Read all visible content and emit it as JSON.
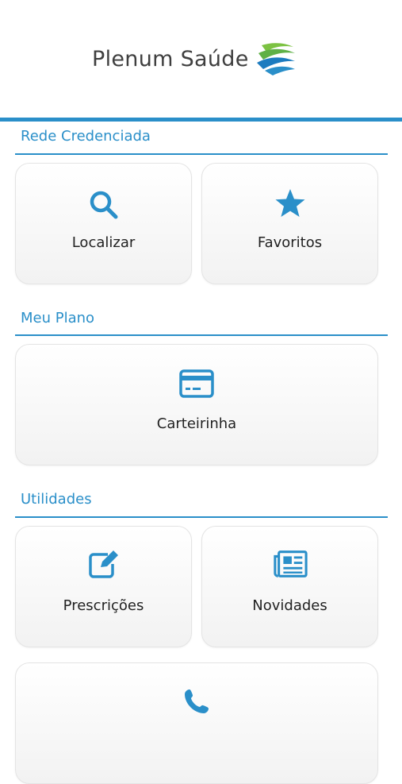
{
  "header": {
    "logo_text": "Plenum Saúde"
  },
  "colors": {
    "accent": "#2a8fc9",
    "logo_green": "#7cc242",
    "logo_blue": "#1c7bbf"
  },
  "sections": [
    {
      "title": "Rede Credenciada",
      "cards": [
        {
          "label": "Localizar",
          "icon": "search-icon"
        },
        {
          "label": "Favoritos",
          "icon": "star-icon"
        }
      ]
    },
    {
      "title": "Meu Plano",
      "cards": [
        {
          "label": "Carteirinha",
          "icon": "credit-card-icon"
        }
      ]
    },
    {
      "title": "Utilidades",
      "cards": [
        {
          "label": "Prescrições",
          "icon": "edit-icon"
        },
        {
          "label": "Novidades",
          "icon": "newspaper-icon"
        },
        {
          "label": "",
          "icon": "phone-icon"
        }
      ]
    }
  ]
}
